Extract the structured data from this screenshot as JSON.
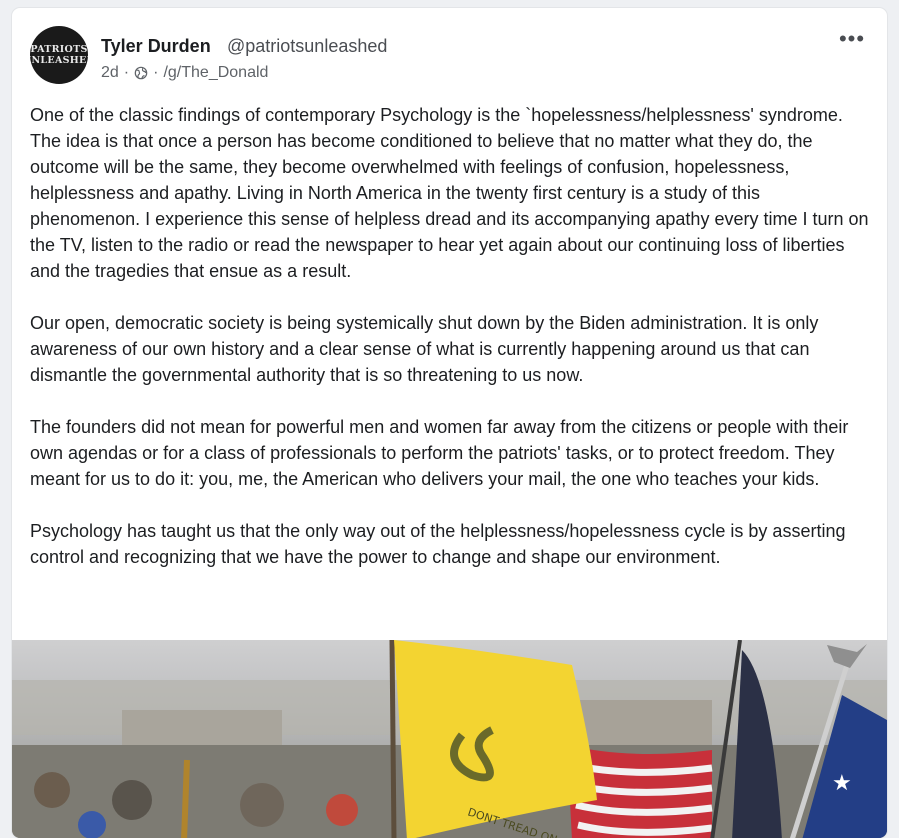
{
  "post": {
    "author_name": "Tyler Durden",
    "author_handle": "@patriotsunleashed",
    "avatar_text": [
      "PATRIOTS",
      "UNLEASHED"
    ],
    "age": "2d",
    "separator": "·",
    "visibility_icon": "globe-icon",
    "community": "/g/The_Donald",
    "more_label": "•••",
    "paragraphs": [
      "One of the classic findings of contemporary Psychology is the `hopelessness/helplessness' syndrome. The idea is that once a person has become conditioned to believe that no matter what they do, the outcome will be the same, they become overwhelmed with feelings of confusion, hopelessness, helplessness and apathy. Living in North America in the twenty first century is a study of this phenomenon. I experience this sense of helpless dread and its accompanying apathy every time I turn on the TV, listen to the radio or read the newspaper to hear yet again about our continuing loss of liberties and the tragedies that ensue as a result.",
      "Our open, democratic society is being systemically shut down by the Biden administration. It is only awareness of our own history and a clear sense of what is currently happening around us that can dismantle the governmental authority that is so threatening to us now.",
      "The founders did not mean for powerful men and women far away from the citizens or people with their own agendas or for a class of professionals to perform the patriots' tasks, or to protect freedom. They meant for us to do it: you, me, the American who delivers your mail, the one who teaches your kids.",
      "Psychology has taught us that the only way out of the helplessness/hopelessness cycle is by asserting control and recognizing that we have the power to change and shape our environment."
    ],
    "image_flag_text": "DONT TREAD ON"
  },
  "colors": {
    "background": "#eef0f3",
    "card": "#ffffff",
    "text": "#1c1e21",
    "flag_yellow": "#f3d431",
    "flag_blue": "#233e86"
  }
}
